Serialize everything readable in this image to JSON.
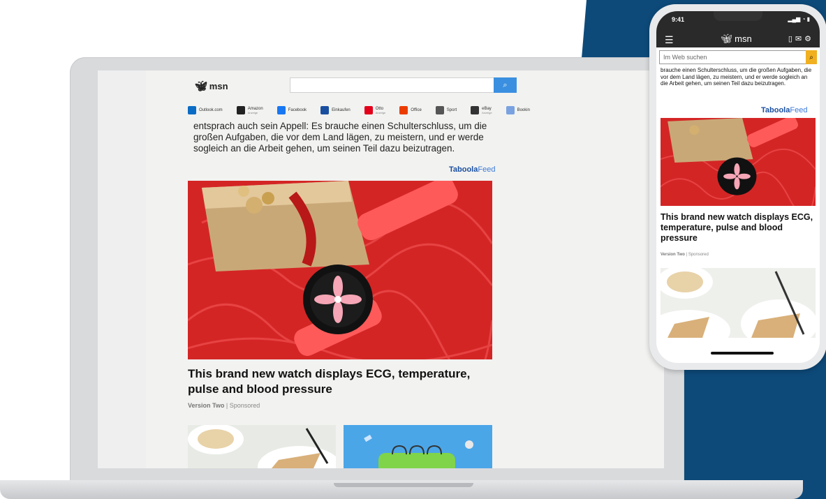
{
  "desktop": {
    "logo": "msn",
    "search": {
      "placeholder": ""
    },
    "quicklinks": [
      {
        "label": "Outlook.com",
        "sub": "",
        "icon": "outlook-icon",
        "color": "#0a6cc4"
      },
      {
        "label": "Amazon",
        "sub": "Anzeige",
        "icon": "amazon-icon",
        "color": "#222222"
      },
      {
        "label": "Facebook",
        "sub": "",
        "icon": "facebook-icon",
        "color": "#1877f2"
      },
      {
        "label": "Einkaufen",
        "sub": "",
        "icon": "cart-icon",
        "color": "#1a4fa0"
      },
      {
        "label": "Otto",
        "sub": "Anzeige",
        "icon": "otto-icon",
        "color": "#e2001a"
      },
      {
        "label": "Office",
        "sub": "",
        "icon": "office-icon",
        "color": "#eb3c00"
      },
      {
        "label": "Sport",
        "sub": "",
        "icon": "sport-icon",
        "color": "#555555"
      },
      {
        "label": "eBay",
        "sub": "Anzeige",
        "icon": "ebay-icon",
        "color": "#333333"
      },
      {
        "label": "Bookin",
        "sub": "",
        "icon": "booking-icon",
        "color": "#7aa2e0"
      }
    ],
    "article_text": "entsprach auch sein Appell: Es brauche einen Schulterschluss, um die großen Aufgaben, die vor dem Land lägen, zu meistern, und er werde sogleich an die Arbeit gehen, um seinen Teil dazu beizutragen.",
    "taboola_brand": "Taboola",
    "taboola_feed": "Feed",
    "ad": {
      "title": "This brand new watch displays ECG, temperature, pulse and blood pressure",
      "source": "Version Two",
      "sponsored": "Sponsored"
    }
  },
  "phone": {
    "time": "9:41",
    "status_icons": "all-signal-wifi-battery",
    "logo": "msn",
    "search_placeholder": "Im Web suchen",
    "article_text": "brauche einen Schulterschluss, um die großen Aufgaben, die vor dem Land lägen, zu meistern, und er werde sogleich an die Arbeit gehen, um seinen Teil dazu beizutragen.",
    "taboola_brand": "Taboola",
    "taboola_feed": "Feed",
    "ad": {
      "title": "This brand new watch displays ECG, temperature, pulse and blood pressure",
      "source": "Version Two",
      "sponsored": "Sponsored"
    }
  },
  "colors": {
    "backdrop_blue": "#0d4a7a",
    "search_button": "#3b8fe0",
    "ad_red": "#d92020",
    "phone_search_button": "#f0b020"
  }
}
